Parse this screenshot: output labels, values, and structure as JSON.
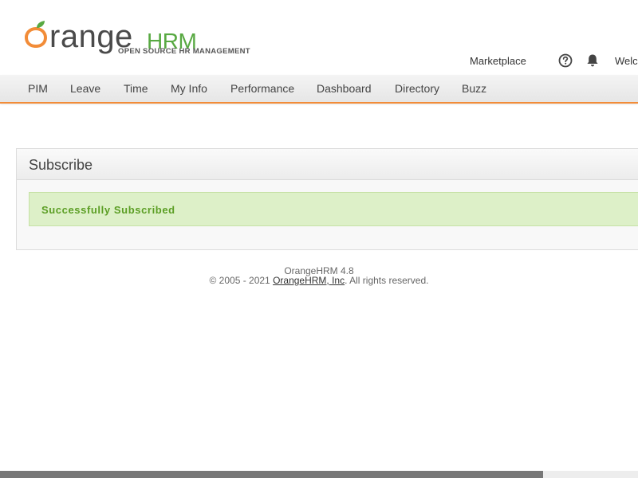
{
  "header": {
    "logo": {
      "word": "range",
      "hrm": "HRM",
      "tagline": "OPEN SOURCE HR MANAGEMENT"
    },
    "marketplace_label": "Marketplace",
    "help_icon": "help-circle-icon",
    "notification_icon": "bell-icon",
    "welcome_label": "Welc"
  },
  "menu": {
    "items": [
      {
        "label": "PIM"
      },
      {
        "label": "Leave"
      },
      {
        "label": "Time"
      },
      {
        "label": "My Info"
      },
      {
        "label": "Performance"
      },
      {
        "label": "Dashboard"
      },
      {
        "label": "Directory"
      },
      {
        "label": "Buzz"
      }
    ],
    "accent_color": "#f28c38"
  },
  "panel": {
    "title": "Subscribe",
    "message": "Successfully Subscribed",
    "message_color": "#5b9e24"
  },
  "footer": {
    "version": "OrangeHRM 4.8",
    "copyright_prefix": "© 2005 - 2021",
    "company_link": "OrangeHRM, Inc",
    "rights": ". All rights reserved."
  }
}
